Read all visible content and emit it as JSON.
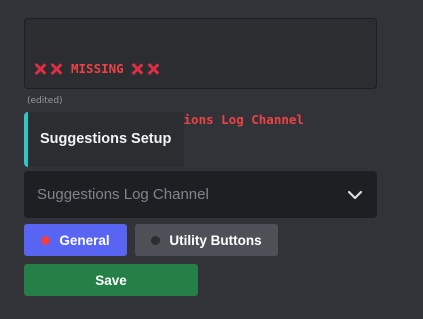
{
  "code_block": {
    "line1_text": "MISSING",
    "line2_text": "- General  > Suggestions Log Channel"
  },
  "message": {
    "edited_label": "(edited)"
  },
  "embed": {
    "title": "Suggestions Setup",
    "accent_color": "#2dc7c4"
  },
  "select_menu": {
    "placeholder": "Suggestions Log Channel",
    "icon": "chevron-down-icon"
  },
  "buttons": {
    "general_label": "General",
    "general_icon": "red-circle-icon",
    "utility_label": "Utility Buttons",
    "utility_icon": "black-circle-icon",
    "save_label": "Save"
  },
  "colors": {
    "background": "#313338",
    "error_red": "#ed4245",
    "blurple": "#5865f2",
    "secondary": "#4e5058",
    "success": "#248046"
  }
}
